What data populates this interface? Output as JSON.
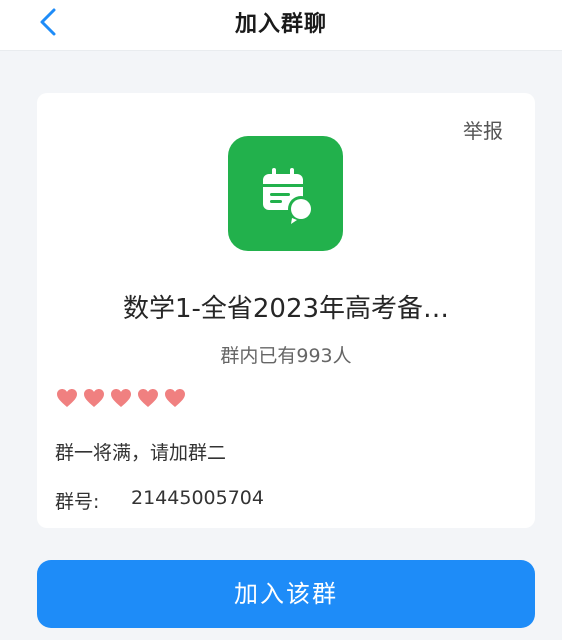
{
  "header": {
    "title": "加入群聊",
    "back_icon": "chevron-left-icon"
  },
  "card": {
    "report_label": "举报",
    "avatar_icon": "calendar-chat-icon",
    "avatar_color": "#22b14c",
    "group_name": "数学1-全省2023年高考备…",
    "member_count": "群内已有993人",
    "hearts_count": 5,
    "heart_color": "#f08080",
    "description": "群一将满，请加群二",
    "group_id_label": "群号:",
    "group_id": "21445005704"
  },
  "footer": {
    "join_label": "加入该群",
    "accent_color": "#1e8cf8"
  }
}
